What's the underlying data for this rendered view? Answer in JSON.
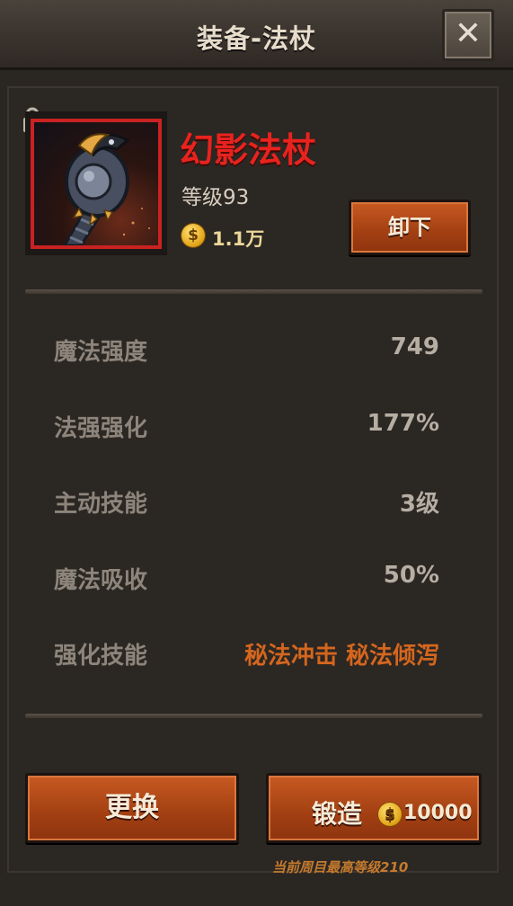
{
  "header": {
    "title": "装备-法杖",
    "close_label": "✕"
  },
  "item": {
    "name": "幻影法杖",
    "level": "等级93",
    "price": "1.1万",
    "coin_symbol": "$",
    "unequip_label": "卸下",
    "locked": true
  },
  "stats": [
    {
      "label": "魔法强度",
      "value": "749"
    },
    {
      "label": "法强强化",
      "value": "177%"
    },
    {
      "label": "主动技能",
      "value": "3级"
    },
    {
      "label": "魔法吸收",
      "value": "50%"
    },
    {
      "label": "强化技能",
      "value": "秘法冲击 秘法倾泻"
    }
  ],
  "actions": {
    "replace_label": "更换",
    "forge_label": "锻造",
    "forge_cost": "10000",
    "coin_symbol": "$"
  },
  "footer_note": "当前周目最高等级210",
  "colors": {
    "item_name": "#e8231e",
    "rarity_border": "#c92222",
    "button": "#a23f12",
    "skill_text": "#d4661e"
  }
}
